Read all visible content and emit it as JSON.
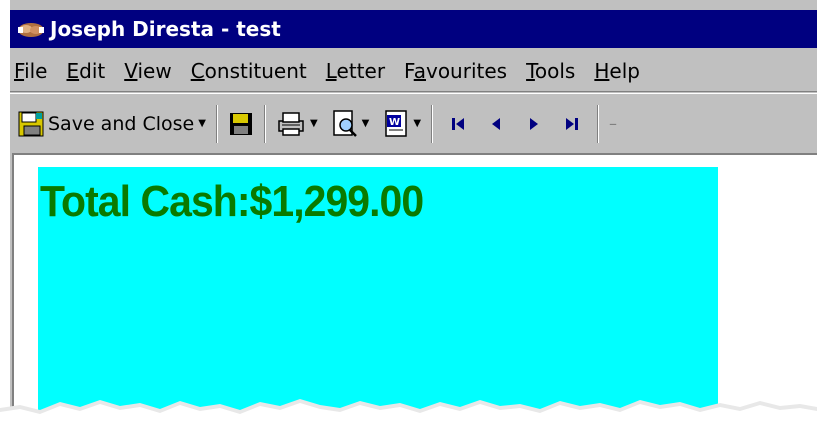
{
  "window": {
    "title": "Joseph Diresta - test",
    "icon": "handshake-icon",
    "titlebar_color": "#000080"
  },
  "menubar": {
    "items": [
      {
        "pre": "",
        "key": "F",
        "post": "ile"
      },
      {
        "pre": "",
        "key": "E",
        "post": "dit"
      },
      {
        "pre": "",
        "key": "V",
        "post": "iew"
      },
      {
        "pre": "",
        "key": "C",
        "post": "onstituent"
      },
      {
        "pre": "",
        "key": "L",
        "post": "etter"
      },
      {
        "pre": "F",
        "key": "a",
        "post": "vourites"
      },
      {
        "pre": "",
        "key": "T",
        "post": "ools"
      },
      {
        "pre": "",
        "key": "H",
        "post": "elp"
      }
    ]
  },
  "toolbar": {
    "save_close_label": "Save and Close",
    "save_icon": "floppy-disk-icon",
    "print_icon": "printer-icon",
    "preview_icon": "print-preview-icon",
    "word_icon": "word-document-icon",
    "nav_icons": [
      "first-record-icon",
      "previous-record-icon",
      "next-record-icon",
      "last-record-icon"
    ]
  },
  "content": {
    "cash_label": "Total Cash:$1,299.00",
    "panel_color": "#00ffff",
    "text_color": "#0a7a00"
  }
}
